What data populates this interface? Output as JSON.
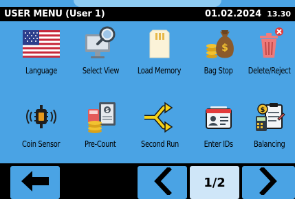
{
  "header": {
    "title": "USER MENU (User 1)",
    "date": "01.02.2024",
    "time": "13.30"
  },
  "menu": [
    {
      "label": "Language",
      "icon": "us-flag-icon"
    },
    {
      "label": "Select View",
      "icon": "monitor-search-icon"
    },
    {
      "label": "Load Memory",
      "icon": "sd-card-icon"
    },
    {
      "label": "Bag Stop",
      "icon": "money-bag-icon"
    },
    {
      "label": "Delete/Reject",
      "icon": "trash-reject-icon"
    },
    {
      "label": "Coin Sensor",
      "icon": "coin-sensor-icon"
    },
    {
      "label": "Pre-Count",
      "icon": "coins-calculator-icon"
    },
    {
      "label": "Second Run",
      "icon": "split-arrows-icon"
    },
    {
      "label": "Enter IDs",
      "icon": "id-card-icon"
    },
    {
      "label": "Balancing",
      "icon": "clipboard-calculator-icon"
    }
  ],
  "footer": {
    "page_indicator": "1/2"
  },
  "colors": {
    "background": "#4aa3e4",
    "header": "#000000",
    "page_button": "#cfe6f8"
  }
}
